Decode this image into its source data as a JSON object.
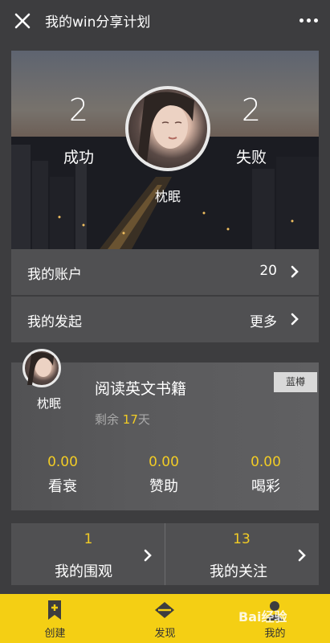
{
  "header": {
    "title": "我的win分享计划"
  },
  "hero": {
    "success_count": "2",
    "success_label": "成功",
    "fail_count": "2",
    "fail_label": "失败",
    "user_name": "枕眠"
  },
  "account_row": {
    "label": "我的账户",
    "value": "20"
  },
  "launch_row": {
    "label": "我的发起",
    "value": "更多"
  },
  "plan_card": {
    "user_name": "枕眠",
    "title": "阅读英文书籍",
    "tag": "蓝樽",
    "remain_prefix": "剩余 ",
    "remain_days": "17",
    "remain_suffix": "天",
    "metrics": [
      {
        "value": "0.00",
        "label": "看衰"
      },
      {
        "value": "0.00",
        "label": "赞助"
      },
      {
        "value": "0.00",
        "label": "喝彩"
      }
    ]
  },
  "bottom": {
    "watch": {
      "count": "1",
      "label": "我的围观"
    },
    "follow": {
      "count": "13",
      "label": "我的关注"
    }
  },
  "tabbar": {
    "tabs": [
      {
        "label": "创建",
        "icon": "bookmark-plus-icon"
      },
      {
        "label": "发现",
        "icon": "compass-icon"
      },
      {
        "label": "我的",
        "icon": "user-icon"
      }
    ]
  },
  "watermark": "Bai经验",
  "colors": {
    "accent": "#f2cc25",
    "tabbar": "#f4cf14",
    "background": "#3d3d3f",
    "panel": "#505052"
  }
}
